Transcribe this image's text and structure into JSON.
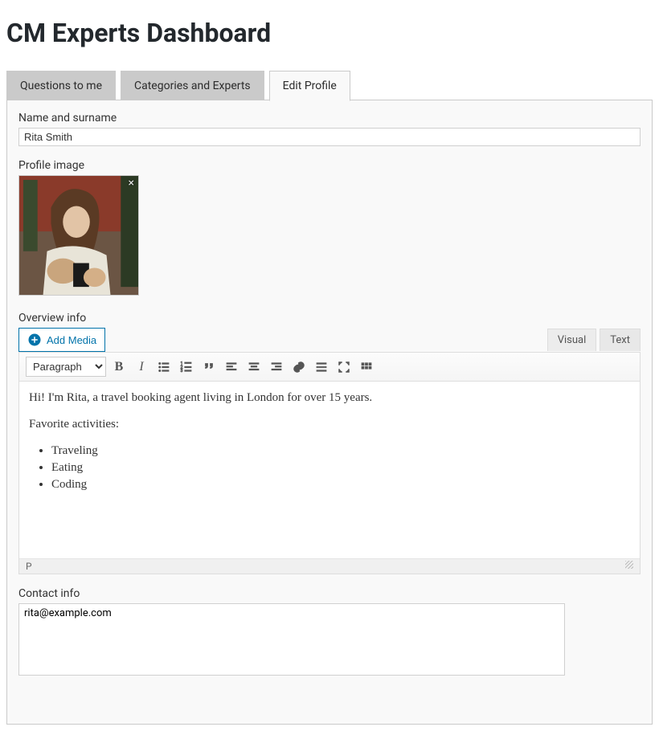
{
  "page_title": "CM Experts Dashboard",
  "tabs": {
    "questions": "Questions to me",
    "categories": "Categories and Experts",
    "edit_profile": "Edit Profile"
  },
  "fields": {
    "name_label": "Name and surname",
    "name_value": "Rita Smith",
    "profile_image_label": "Profile image",
    "profile_close": "×",
    "overview_label": "Overview info",
    "contact_label": "Contact info",
    "contact_value": "rita@example.com"
  },
  "editor": {
    "add_media": "Add Media",
    "tab_visual": "Visual",
    "tab_text": "Text",
    "format_option": "Paragraph",
    "status_path": "P",
    "content": {
      "intro": "Hi! I'm Rita, a travel booking agent living in London for over 15 years.",
      "fav_heading": "Favorite activities:",
      "items": {
        "0": "Traveling",
        "1": "Eating",
        "2": "Coding"
      }
    }
  }
}
